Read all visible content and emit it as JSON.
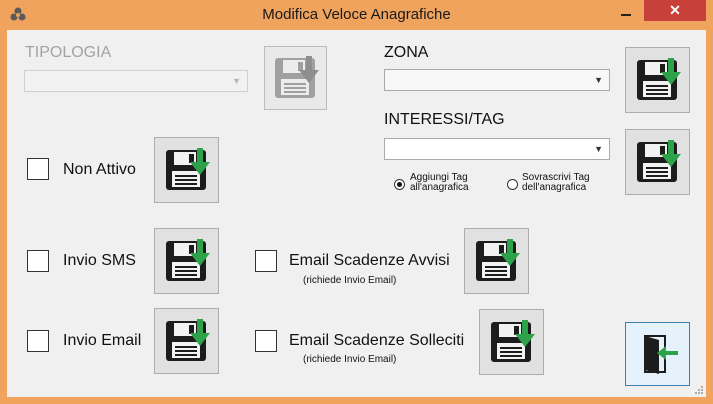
{
  "window": {
    "title": "Modifica Veloce Anagrafiche",
    "close_label": "✕",
    "app_icon": "trefoil-app-icon",
    "frame_color": "#efa35c"
  },
  "tipologia": {
    "label": "TIPOLOGIA",
    "value": ""
  },
  "zona": {
    "label": "ZONA",
    "value": ""
  },
  "interessi": {
    "label": "INTERESSI/TAG",
    "value": "",
    "radio_add_label": "Aggiungi  Tag all'anagrafica",
    "radio_overwrite_label": "Sovrascrivi Tag dell'anagrafica",
    "radio_add_selected": true
  },
  "checkboxes": {
    "non_attivo": "Non Attivo",
    "invio_sms": "Invio SMS",
    "invio_email": "Invio Email",
    "email_scadenze_avvisi": "Email Scadenze Avvisi",
    "email_scadenze_avvisi_note": "(richiede Invio Email)",
    "email_scadenze_solleciti": "Email Scadenze Solleciti",
    "email_scadenze_solleciti_note": "(richiede Invio Email)"
  },
  "icons": {
    "save": "floppy-disk-save-icon",
    "exit": "exit-door-icon",
    "save_arrow_color": "#2ea24a",
    "exit_arrow_color": "#2ea24a"
  }
}
